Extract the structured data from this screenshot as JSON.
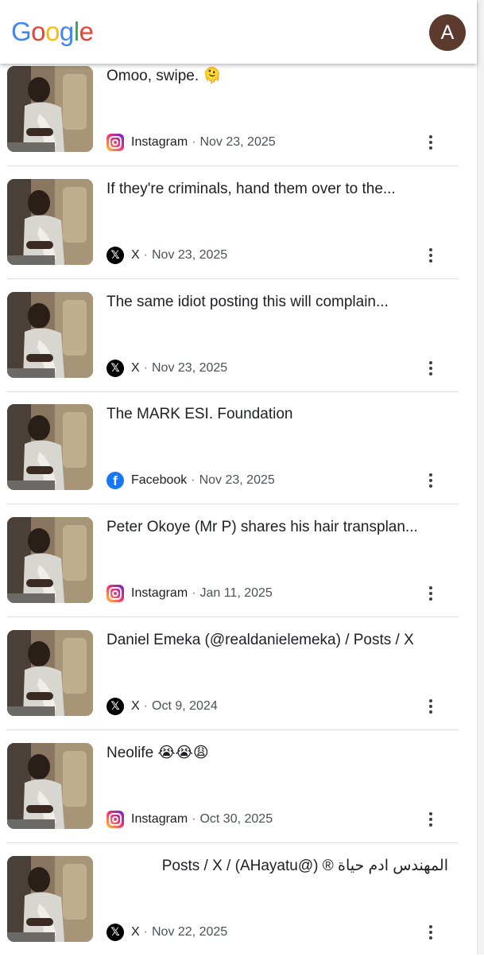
{
  "header": {
    "logo_letters": [
      "G",
      "o",
      "o",
      "g",
      "l",
      "e"
    ],
    "logo_colors": [
      "#4285F4",
      "#EA4335",
      "#FBBC05",
      "#4285F4",
      "#34A853",
      "#EA4335"
    ],
    "avatar_letter": "A"
  },
  "colors": {
    "instagram": "#E1306C",
    "x": "#000000",
    "facebook": "#1877F2"
  },
  "results": [
    {
      "title": "Omoo, swipe. 🫠",
      "source": "Instagram",
      "icon": "instagram-icon",
      "date": "Nov 23, 2025"
    },
    {
      "title": "If they're criminals, hand them over to the...",
      "source": "X",
      "icon": "x-icon",
      "date": "Nov 23, 2025"
    },
    {
      "title": "The same idiot posting this will complain...",
      "source": "X",
      "icon": "x-icon",
      "date": "Nov 23, 2025"
    },
    {
      "title": "The MARK ESI. Foundation",
      "source": "Facebook",
      "icon": "facebook-icon",
      "date": "Nov 23, 2025"
    },
    {
      "title": "Peter Okoye (Mr P) shares his hair transplan...",
      "source": "Instagram",
      "icon": "instagram-icon",
      "date": "Jan 11, 2025"
    },
    {
      "title": "Daniel Emeka (@realdanielemeka) / Posts / X",
      "source": "X",
      "icon": "x-icon",
      "date": "Oct 9, 2024"
    },
    {
      "title": "Neolife 😭😭😩",
      "source": "Instagram",
      "icon": "instagram-icon",
      "date": "Oct 30, 2025"
    },
    {
      "title": "المهندس ادم حياة ® (@AHayatu) / Posts / X",
      "source": "X",
      "icon": "x-icon",
      "date": "Nov 22, 2025"
    }
  ],
  "separator": "·"
}
